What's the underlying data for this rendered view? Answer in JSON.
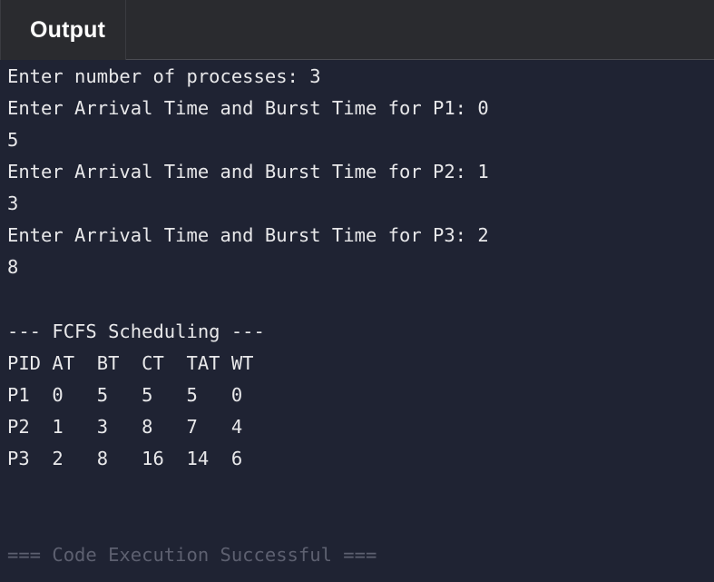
{
  "header": {
    "title": "Output"
  },
  "console": {
    "lines": [
      "Enter number of processes: 3",
      "Enter Arrival Time and Burst Time for P1: 0",
      "5",
      "Enter Arrival Time and Burst Time for P2: 1",
      "3",
      "Enter Arrival Time and Burst Time for P3: 2",
      "8",
      "",
      "--- FCFS Scheduling ---",
      "PID AT  BT  CT  TAT WT",
      "P1  0   5   5   5   0",
      "P2  1   3   8   7   4",
      "P3  2   8   16  14  6"
    ],
    "status": "=== Code Execution Successful ==="
  },
  "colors": {
    "background": "#1f2333",
    "header": "#2a2b2f",
    "text": "#e8e8ea",
    "muted": "#5d6070"
  }
}
